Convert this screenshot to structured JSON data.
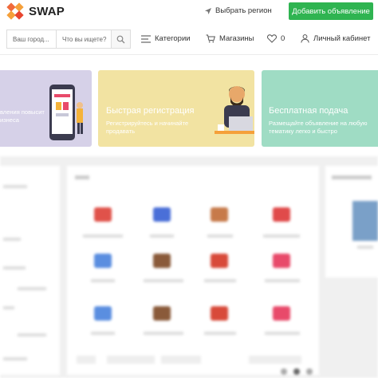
{
  "header": {
    "logo_text": "SWAP",
    "region_label": "Выбрать регион",
    "add_button": "Добавить объявление"
  },
  "search": {
    "city_placeholder": "Ваш город...",
    "query_placeholder": "Что вы ищете?"
  },
  "nav": {
    "categories": "Категории",
    "shops": "Магазины",
    "favorites_count": "0",
    "cabinet": "Личный кабинет"
  },
  "banners": [
    {
      "title": "",
      "subtitle": "вления повысит\nизнеса"
    },
    {
      "title": "Быстрая регистрация",
      "subtitle": "Регистрируйтесь и начинайте\nпродавать"
    },
    {
      "title": "Бесплатная подача",
      "subtitle": "Размещайте объявление на любую\nтематику легко и быстро"
    }
  ],
  "colors": {
    "accent_green": "#2fb451",
    "banner_purple": "#d6d1e8",
    "banner_yellow": "#f2e3a2",
    "banner_mint": "#9fdcc4",
    "logo_orange": "#f06a3b"
  },
  "icons": [
    "location-arrow-icon",
    "search-icon",
    "menu-icon",
    "cart-icon",
    "heart-icon",
    "user-icon"
  ]
}
